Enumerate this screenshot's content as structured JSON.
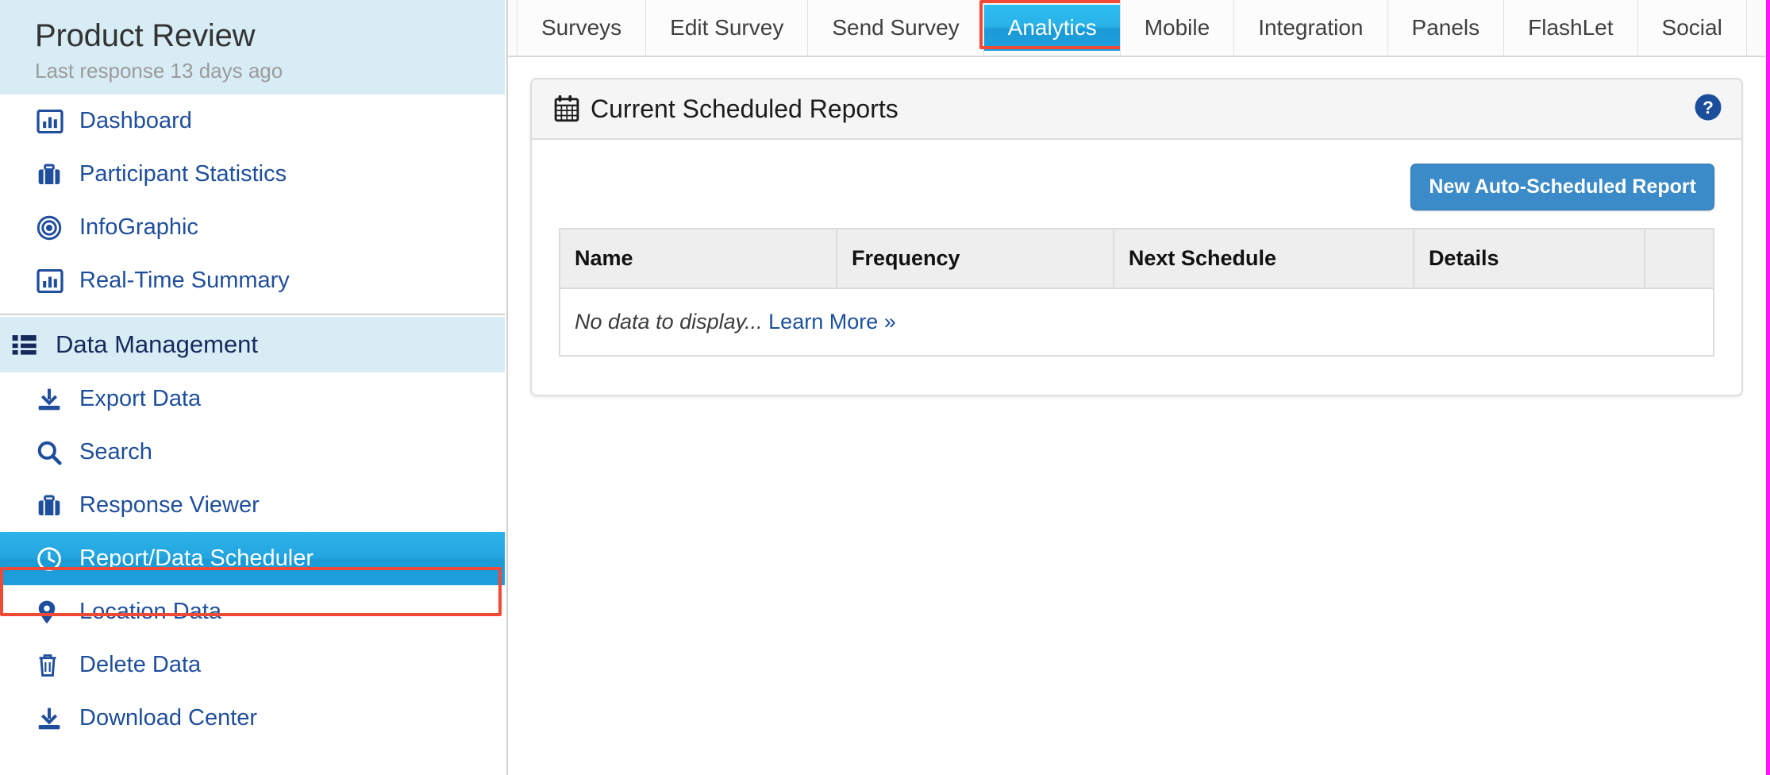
{
  "sidebar": {
    "survey_title": "Product Review",
    "last_response": "Last response 13 days ago",
    "primary_items": [
      {
        "label": "Dashboard",
        "icon": "chart-bar-icon"
      },
      {
        "label": "Participant Statistics",
        "icon": "briefcase-icon"
      },
      {
        "label": "InfoGraphic",
        "icon": "target-icon"
      },
      {
        "label": "Real-Time Summary",
        "icon": "chart-bar-icon"
      }
    ],
    "section": {
      "label": "Data Management",
      "icon": "list-icon"
    },
    "section_items": [
      {
        "label": "Export Data",
        "icon": "download-icon",
        "active": false
      },
      {
        "label": "Search",
        "icon": "search-icon",
        "active": false
      },
      {
        "label": "Response Viewer",
        "icon": "briefcase-icon",
        "active": false
      },
      {
        "label": "Report/Data Scheduler",
        "icon": "clock-icon",
        "active": true
      },
      {
        "label": "Location Data",
        "icon": "map-pin-icon",
        "active": false
      },
      {
        "label": "Delete Data",
        "icon": "trash-icon",
        "active": false
      },
      {
        "label": "Download Center",
        "icon": "download-icon",
        "active": false
      }
    ]
  },
  "tabs": [
    {
      "label": "Surveys",
      "active": false
    },
    {
      "label": "Edit Survey",
      "active": false
    },
    {
      "label": "Send Survey",
      "active": false
    },
    {
      "label": "Analytics",
      "active": true
    },
    {
      "label": "Mobile",
      "active": false
    },
    {
      "label": "Integration",
      "active": false
    },
    {
      "label": "Panels",
      "active": false
    },
    {
      "label": "FlashLet",
      "active": false
    },
    {
      "label": "Social",
      "active": false
    }
  ],
  "panel": {
    "title": "Current Scheduled Reports",
    "title_icon": "calendar-icon",
    "help_icon": "help-circle-icon",
    "new_report_button": "New Auto-Scheduled Report",
    "table": {
      "columns": [
        "Name",
        "Frequency",
        "Next Schedule",
        "Details",
        ""
      ],
      "rows": [],
      "empty_text": "No data to display...",
      "empty_link": "Learn More »"
    }
  },
  "annotations": {
    "arrow_color": "#e8412e",
    "highlight_border_color": "#f04a36",
    "selection_border_color": "#f916f9"
  }
}
